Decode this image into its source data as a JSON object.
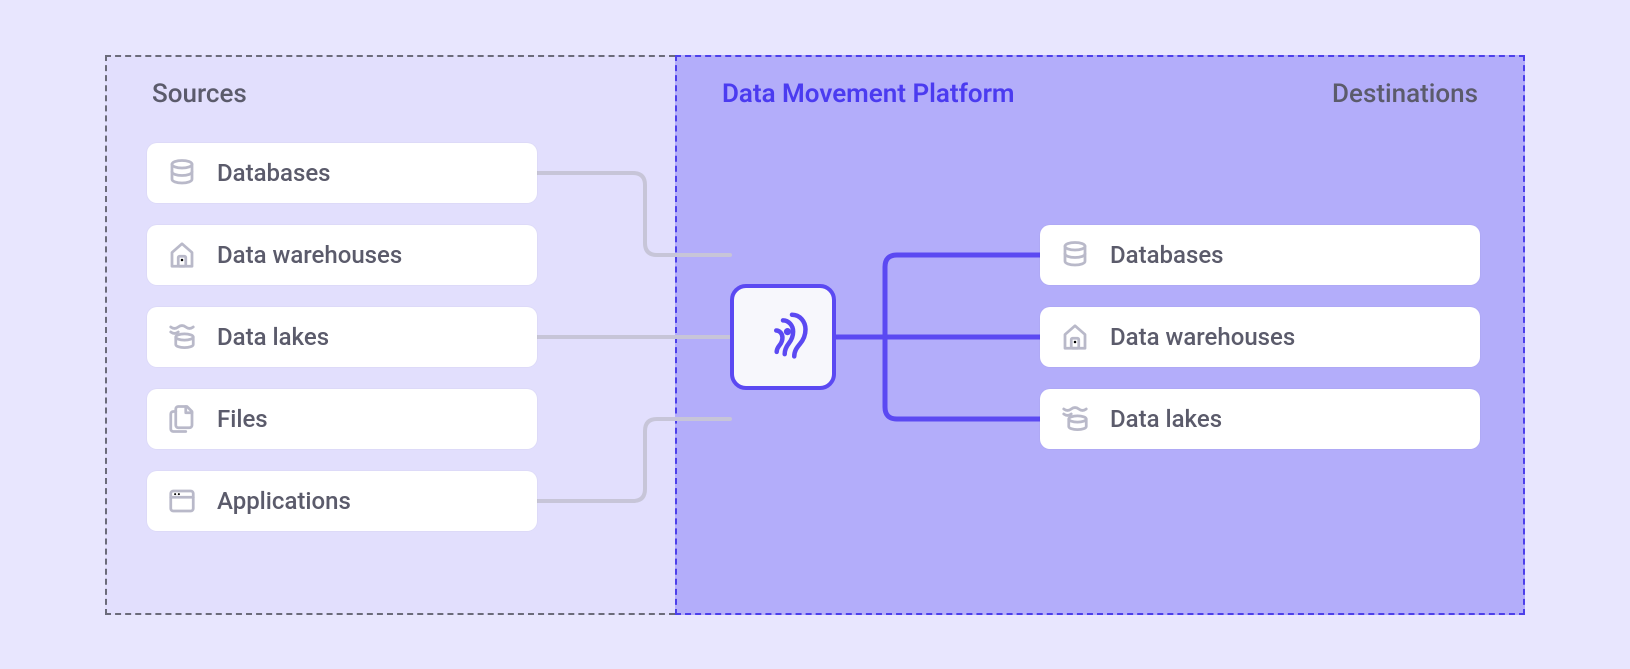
{
  "sources_title": "Sources",
  "platform_title": "Data Movement Platform",
  "destinations_title": "Destinations",
  "sources": [
    {
      "label": "Databases",
      "icon": "database"
    },
    {
      "label": "Data warehouses",
      "icon": "warehouse"
    },
    {
      "label": "Data lakes",
      "icon": "lake"
    },
    {
      "label": "Files",
      "icon": "files"
    },
    {
      "label": "Applications",
      "icon": "app"
    }
  ],
  "destinations": [
    {
      "label": "Databases",
      "icon": "database"
    },
    {
      "label": "Data warehouses",
      "icon": "warehouse"
    },
    {
      "label": "Data lakes",
      "icon": "lake"
    }
  ],
  "hub_icon": "octopus"
}
